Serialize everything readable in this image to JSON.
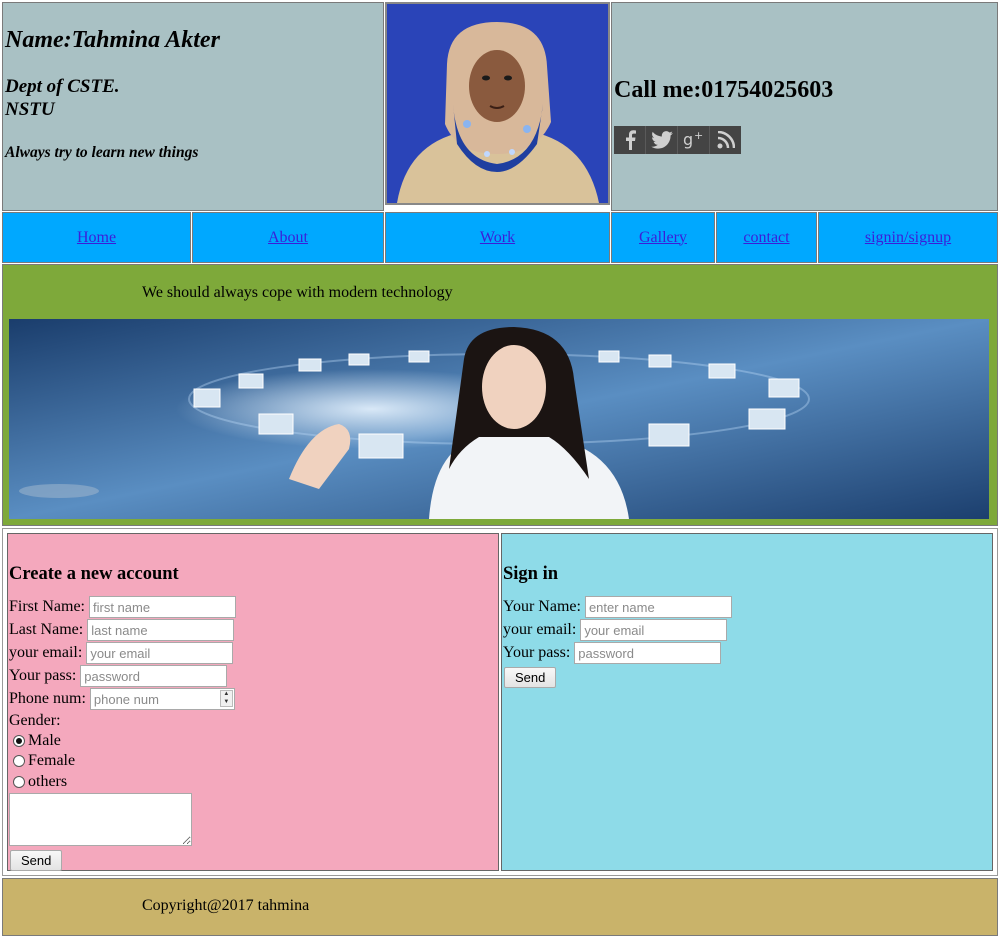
{
  "header": {
    "name": "Name:Tahmina Akter",
    "dept_line1": "Dept of CSTE.",
    "dept_line2": "NSTU",
    "motto": "Always try to learn new things",
    "call": "Call me:01754025603",
    "social_icons": [
      "facebook-icon",
      "twitter-icon",
      "google-plus-icon",
      "rss-icon"
    ]
  },
  "nav": {
    "items": [
      {
        "label": "Home"
      },
      {
        "label": "About"
      },
      {
        "label": "Work"
      },
      {
        "label": "Gallery"
      },
      {
        "label": "contact"
      },
      {
        "label": "signin/signup"
      }
    ]
  },
  "banner": {
    "text": "We should always cope with modern technology"
  },
  "register": {
    "title": "Create a new account",
    "first_name_label": "First Name:",
    "first_name_placeholder": "first name",
    "last_name_label": "Last Name:",
    "last_name_placeholder": "last name",
    "email_label": "your email:",
    "email_placeholder": "your email",
    "pass_label": "Your pass:",
    "pass_placeholder": "password",
    "phone_label": "Phone num:",
    "phone_placeholder": "phone num",
    "gender_label": "Gender:",
    "gender_options": [
      "Male",
      "Female",
      "others"
    ],
    "gender_selected": "Male",
    "send_label": "Send"
  },
  "signin": {
    "title": "Sign in",
    "name_label": "Your Name:",
    "name_placeholder": "enter name",
    "email_label": "your email:",
    "email_placeholder": "your email",
    "pass_label": "Your pass:",
    "pass_placeholder": "password",
    "send_label": "Send"
  },
  "footer": {
    "copyright": "Copyright@2017 tahmina"
  },
  "colors": {
    "header_bg": "#a9c1c4",
    "nav_bg": "#00a8ff",
    "banner_bg": "#7ea93a",
    "register_bg": "#f4a8bd",
    "signin_bg": "#8edbe8",
    "footer_bg": "#c9b36a"
  }
}
